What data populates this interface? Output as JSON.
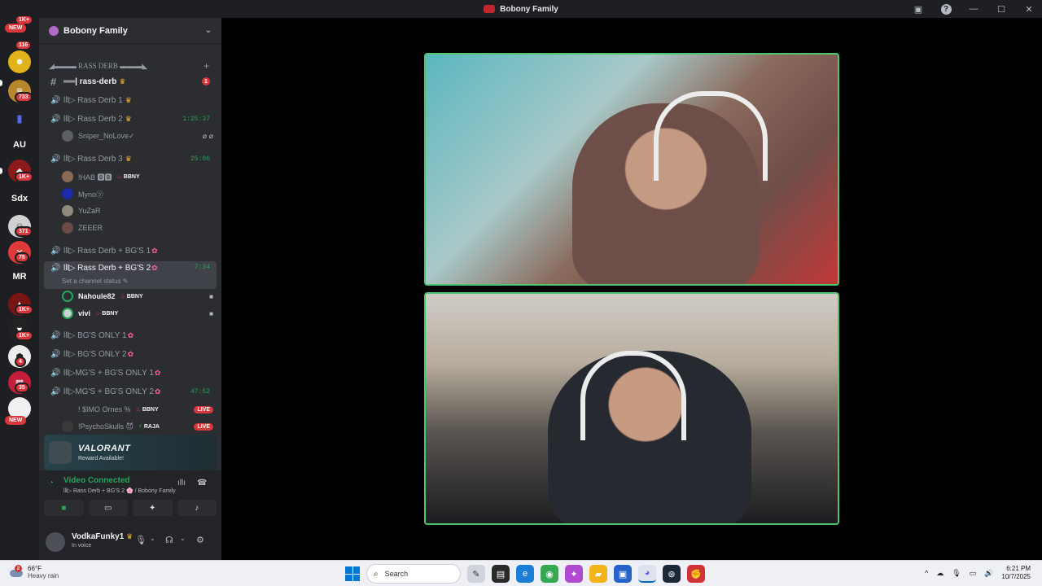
{
  "window": {
    "title": "Bobony Family"
  },
  "rail": {
    "new_label_top": "NEW",
    "badge_1": "1K+",
    "badge_2": "116",
    "badge_3": "733",
    "text_au": "AU",
    "badge_4": "1K+",
    "text_sdx": "Sdx",
    "badge_5": "371",
    "badge_6": "75",
    "text_mr": "MR",
    "badge_7": "1K+",
    "badge_8": "1K+",
    "badge_9": "4",
    "badge_10": "35",
    "new_label_bottom": "NEW"
  },
  "guild": {
    "name": "Bobony Family"
  },
  "channels": {
    "category": "◢▬▬▬ RASS DERB ▬▬▬◣",
    "text_channel": "══| rass-derb",
    "text_unread": "1",
    "voice": [
      {
        "name": "lll▷ Rass Derb 1",
        "time": ""
      },
      {
        "name": "lll▷ Rass Derb 2",
        "time": "1:25:37"
      },
      {
        "name": "lll▷ Rass Derb 3",
        "time": "25:06"
      },
      {
        "name": "lll▷ Rass Derb + BG'S 1",
        "time": ""
      },
      {
        "name": "lll▷ Rass Derb + BG'S 2",
        "time": "7:34"
      },
      {
        "name": "lll▷ BG'S ONLY 1",
        "time": ""
      },
      {
        "name": "lll▷ BG'S ONLY 2",
        "time": ""
      },
      {
        "name": "lll▷MG'S + BG'S ONLY 1",
        "time": ""
      },
      {
        "name": "lll▷MG'S + BG'S ONLY 2",
        "time": "47:52"
      }
    ],
    "set_status": "Set a channel status",
    "members_rd2": [
      "Sniper_NoLove✓"
    ],
    "members_rd3": [
      "!HAB 🅱🅱",
      "Myno㋡",
      "YuZaR",
      "ZEEER"
    ],
    "members_rd3_tag": "BBNY",
    "members_bg2": [
      {
        "name": "Nahoule82",
        "tag": "BBNY"
      },
      {
        "name": "vivi",
        "tag": "BBNY"
      }
    ],
    "members_mg2": [
      {
        "name": "! $IMO Ornes %",
        "tag": "BBNY",
        "live": "LIVE"
      },
      {
        "name": "!PsychoSkulls 😈",
        "tag": "RAJA",
        "live": "LIVE"
      }
    ]
  },
  "promo": {
    "title": "VALORANT",
    "subtitle": "Reward Available!"
  },
  "voice_panel": {
    "status": "Video Connected",
    "location": "lll▷ Rass Derb + BG'S 2 🌸 / Bobony Family"
  },
  "user": {
    "name": "VodkaFunky1",
    "status": "In voice"
  },
  "taskbar": {
    "temp": "66°F",
    "condition": "Heavy rain",
    "weather_badge": "2",
    "search": "Search",
    "time": "6:21 PM",
    "date": "10/7/2025"
  },
  "colors": {
    "accent_green": "#23a55a",
    "badge_red": "#da373c",
    "tile_border": "#4fc56f"
  }
}
